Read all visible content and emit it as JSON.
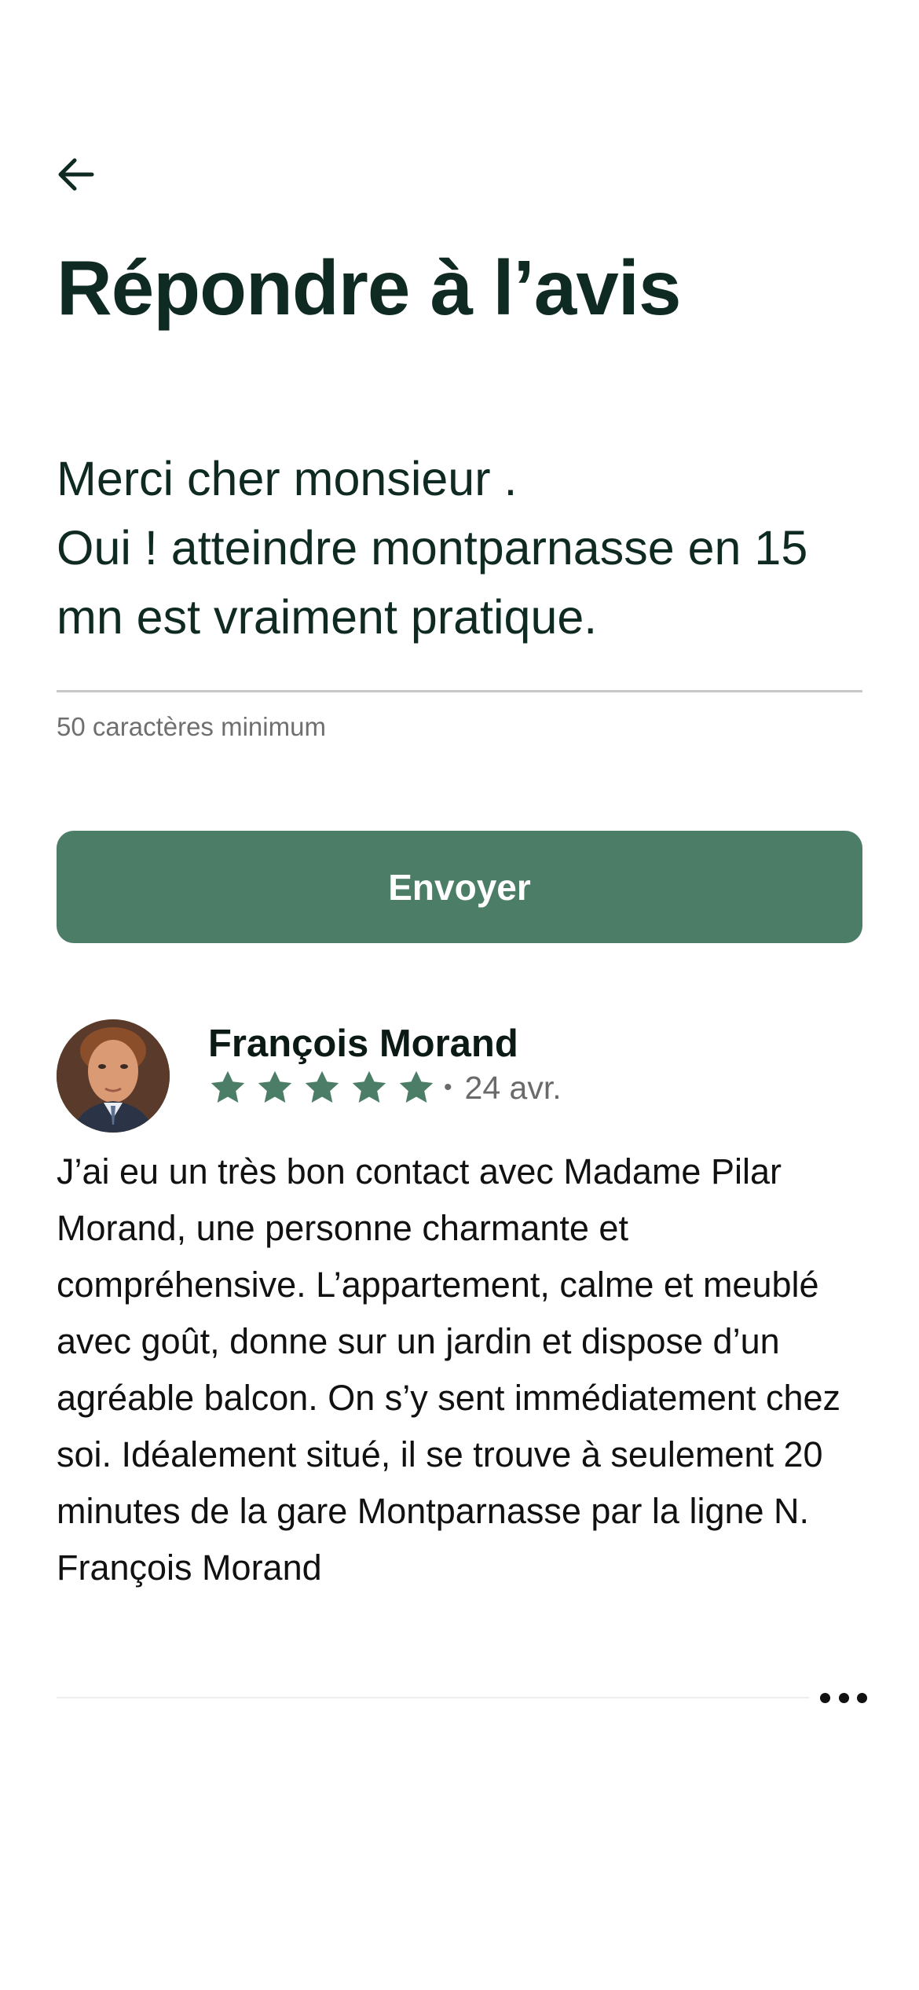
{
  "header": {
    "back_icon": "arrow-left-icon",
    "title": "Répondre à l’avis"
  },
  "reply": {
    "text": "Merci cher monsieur .\nOui ! atteindre montparnasse en 15 mn est vraiment pratique.",
    "helper": "50 caractères minimum"
  },
  "actions": {
    "send_label": "Envoyer"
  },
  "review": {
    "author": "François Morand",
    "rating": 5,
    "rating_max": 5,
    "separator": "•",
    "date": "24 avr.",
    "body": [
      "J’ai eu un très bon contact avec Madame Pilar Morand, une personne charmante et compréhensive. L’appartement, calme et meublé avec goût, donne sur un jardin et dispose d’un agréable balcon. On s’y sent immédiatement chez soi. Idéalement situé, il se trouve à seulement 20 minutes de la gare Montparnasse par la ligne N.",
      "François Morand"
    ],
    "more_icon": "more-horizontal-icon"
  },
  "colors": {
    "accent": "#4c7d66",
    "title": "#0f2a22",
    "helper": "#6f6f6f",
    "divider": "#c8c8c8"
  }
}
